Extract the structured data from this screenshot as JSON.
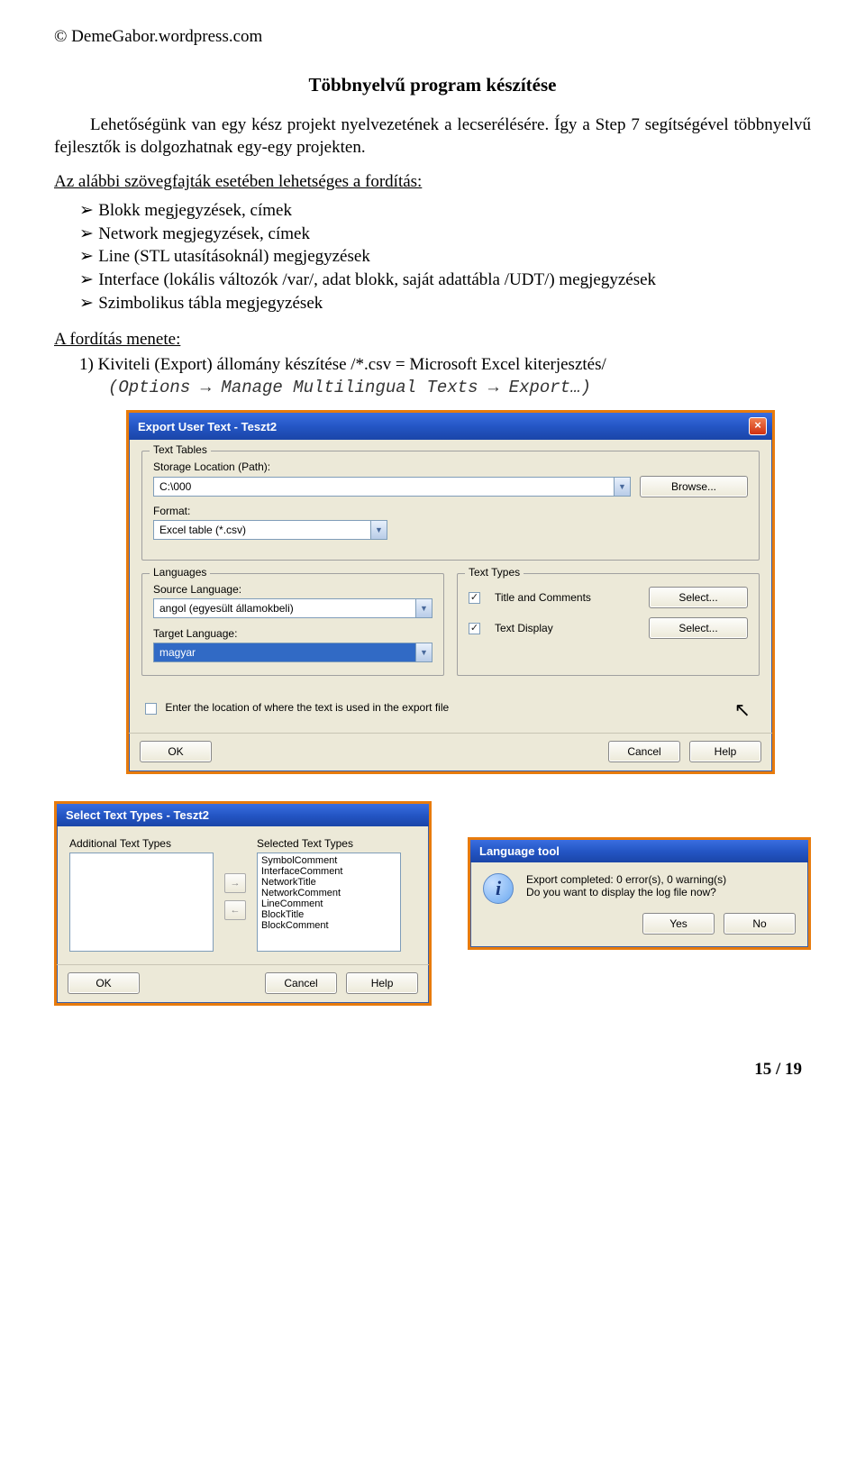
{
  "header": {
    "copyright": "© DemeGabor.wordpress.com"
  },
  "title": "Többnyelvű program készítése",
  "para1_a": "Lehetőségünk van egy kész projekt nyelvezetének a lecserélésére. Így a Step 7 segítségével többnyelvű fejlesztők is dolgozhatnak egy-egy projekten.",
  "list_intro": "Az alábbi szövegfajták esetében lehetséges a fordítás:",
  "bullets": [
    "Blokk megjegyzések, címek",
    "Network megjegyzések, címek",
    "Line (STL utasításoknál) megjegyzések",
    "Interface (lokális változók /var/, adat blokk, saját adattábla /UDT/) megjegyzések",
    "Szimbolikus tábla megjegyzések"
  ],
  "proc_label": "A fordítás menete:",
  "proc_item1_a": "1)   Kiviteli (Export) állomány készítése /*.csv = Microsoft Excel kiterjesztés/",
  "proc_item1_b": "(Options → Manage Multilingual Texts → Export…)",
  "dialog1": {
    "title": "Export User Text - Teszt2",
    "g1": "Text Tables",
    "storage_label": "Storage Location (Path):",
    "storage_value": "C:\\000",
    "browse": "Browse...",
    "format_label": "Format:",
    "format_value": "Excel table (*.csv)",
    "g2": "Languages",
    "src_label": "Source Language:",
    "src_value": "angol (egyesült államokbeli)",
    "tgt_label": "Target Language:",
    "tgt_value": "magyar",
    "g3": "Text Types",
    "chk1": "Title and Comments",
    "chk2": "Text Display",
    "select": "Select...",
    "chk3": "Enter the location of where the text is used in the export file",
    "ok": "OK",
    "cancel": "Cancel",
    "help": "Help"
  },
  "dialog2": {
    "title": "Select Text Types - Teszt2",
    "col1": "Additional Text Types",
    "col2": "Selected Text Types",
    "items": [
      "SymbolComment",
      "InterfaceComment",
      "NetworkTitle",
      "NetworkComment",
      "LineComment",
      "BlockTitle",
      "BlockComment"
    ],
    "ok": "OK",
    "cancel": "Cancel",
    "help": "Help"
  },
  "dialog3": {
    "title": "Language tool",
    "msg1": "Export completed: 0 error(s), 0 warning(s)",
    "msg2": "Do you want to display the log file now?",
    "yes": "Yes",
    "no": "No"
  },
  "footer": "15 / 19"
}
